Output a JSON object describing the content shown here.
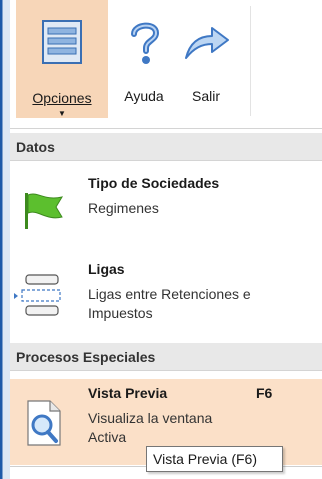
{
  "ribbon": {
    "opciones_label": "Opciones",
    "ayuda_label": "Ayuda",
    "salir_label": "Salir"
  },
  "menu": {
    "sections": [
      {
        "header": "Datos",
        "items": [
          {
            "title": "Tipo de Sociedades",
            "desc": "Regimenes",
            "icon": "flag-icon"
          },
          {
            "title": "Ligas",
            "desc": "Ligas entre Retenciones e Impuestos",
            "icon": "link-lists-icon"
          }
        ]
      },
      {
        "header": "Procesos Especiales",
        "items": [
          {
            "title": "Vista Previa",
            "shortcut": "F6",
            "desc": "Visualiza la ventana Activa",
            "icon": "preview-icon"
          }
        ]
      }
    ]
  },
  "tooltip": {
    "text": "Vista Previa (F6)"
  },
  "colors": {
    "highlight": "#f7d6b8",
    "item_highlight": "#fbe0c8",
    "accent_blue": "#1e5aa8",
    "flag_green": "#4caf2a"
  }
}
